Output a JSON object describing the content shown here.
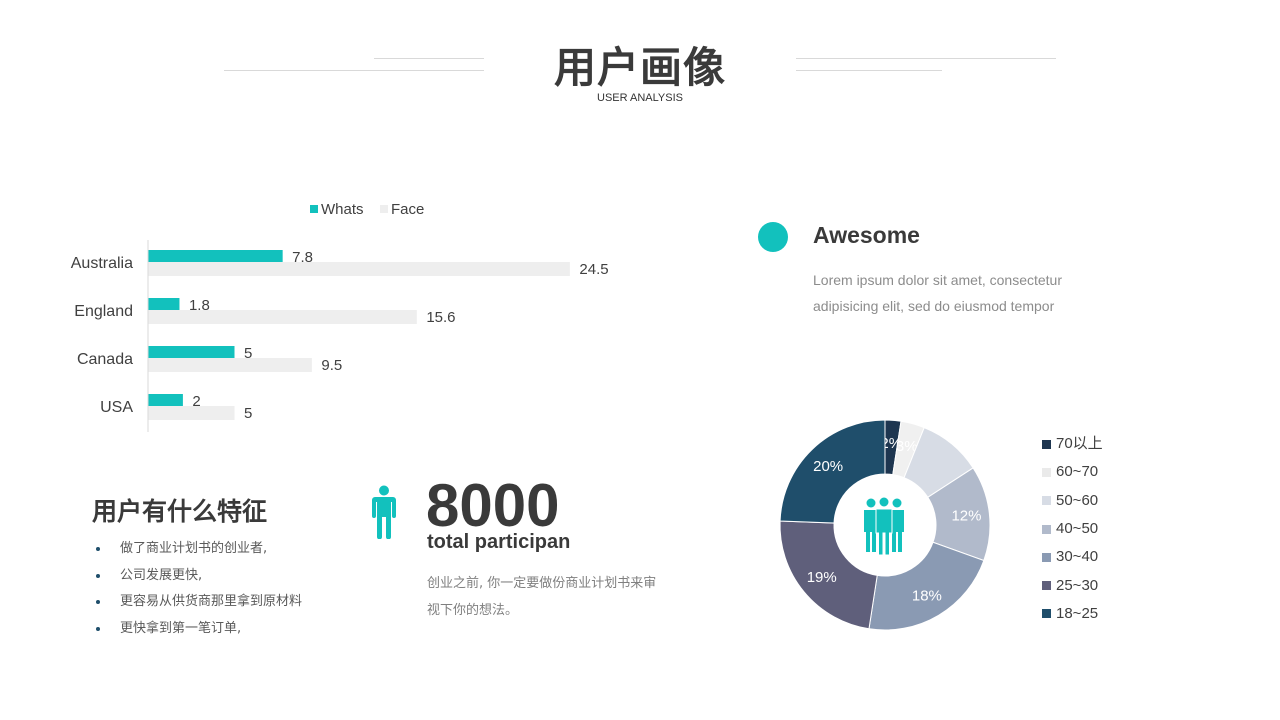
{
  "header": {
    "title": "用户画像",
    "subtitle": "USER ANALYSIS"
  },
  "chart_data": [
    {
      "type": "bar",
      "orientation": "horizontal",
      "categories": [
        "Australia",
        "England",
        "Canada",
        "USA"
      ],
      "series": [
        {
          "name": "Whats",
          "values": [
            7.8,
            1.8,
            5,
            2
          ],
          "color": "#12c1bd"
        },
        {
          "name": "Face",
          "values": [
            24.5,
            15.6,
            9.5,
            5
          ],
          "color": "#eeeeee"
        }
      ],
      "legend_position": "top",
      "grid": false
    },
    {
      "type": "pie",
      "donut": true,
      "slices": [
        {
          "label": "70以上",
          "value": 2,
          "color": "#1e3650",
          "display": "2%"
        },
        {
          "label": "60~70",
          "value": 3,
          "color": "#f0f0f0",
          "display": "3%"
        },
        {
          "label": "50~60",
          "value": 8,
          "color": "#d7dce5",
          "display": ""
        },
        {
          "label": "40~50",
          "value": 12,
          "color": "#b1bacb",
          "display": "12%"
        },
        {
          "label": "30~40",
          "value": 18,
          "color": "#8a9ab3",
          "display": "18%"
        },
        {
          "label": "25~30",
          "value": 19,
          "color": "#5f5f7b",
          "display": "19%"
        },
        {
          "label": "18~25",
          "value": 20,
          "color": "#1f4e6b",
          "display": "20%"
        }
      ],
      "legend_position": "right"
    }
  ],
  "features": {
    "title": "用户有什么特征",
    "items": [
      "做了商业计划书的创业者,",
      "公司发展更快,",
      "更容易从供货商那里拿到原材料",
      "更快拿到第一笔订单,"
    ]
  },
  "participants": {
    "icon": "person-icon",
    "count": "8000",
    "label": "total participan",
    "description": "创业之前, 你一定要做份商业计划书来审视下你的想法。"
  },
  "awesome": {
    "title": "Awesome",
    "description": "Lorem ipsum dolor sit amet, consectetur adipisicing elit, sed do eiusmod tempor",
    "accent": "#12c1bd"
  },
  "donut_center": {
    "icon": "people-group-icon"
  }
}
